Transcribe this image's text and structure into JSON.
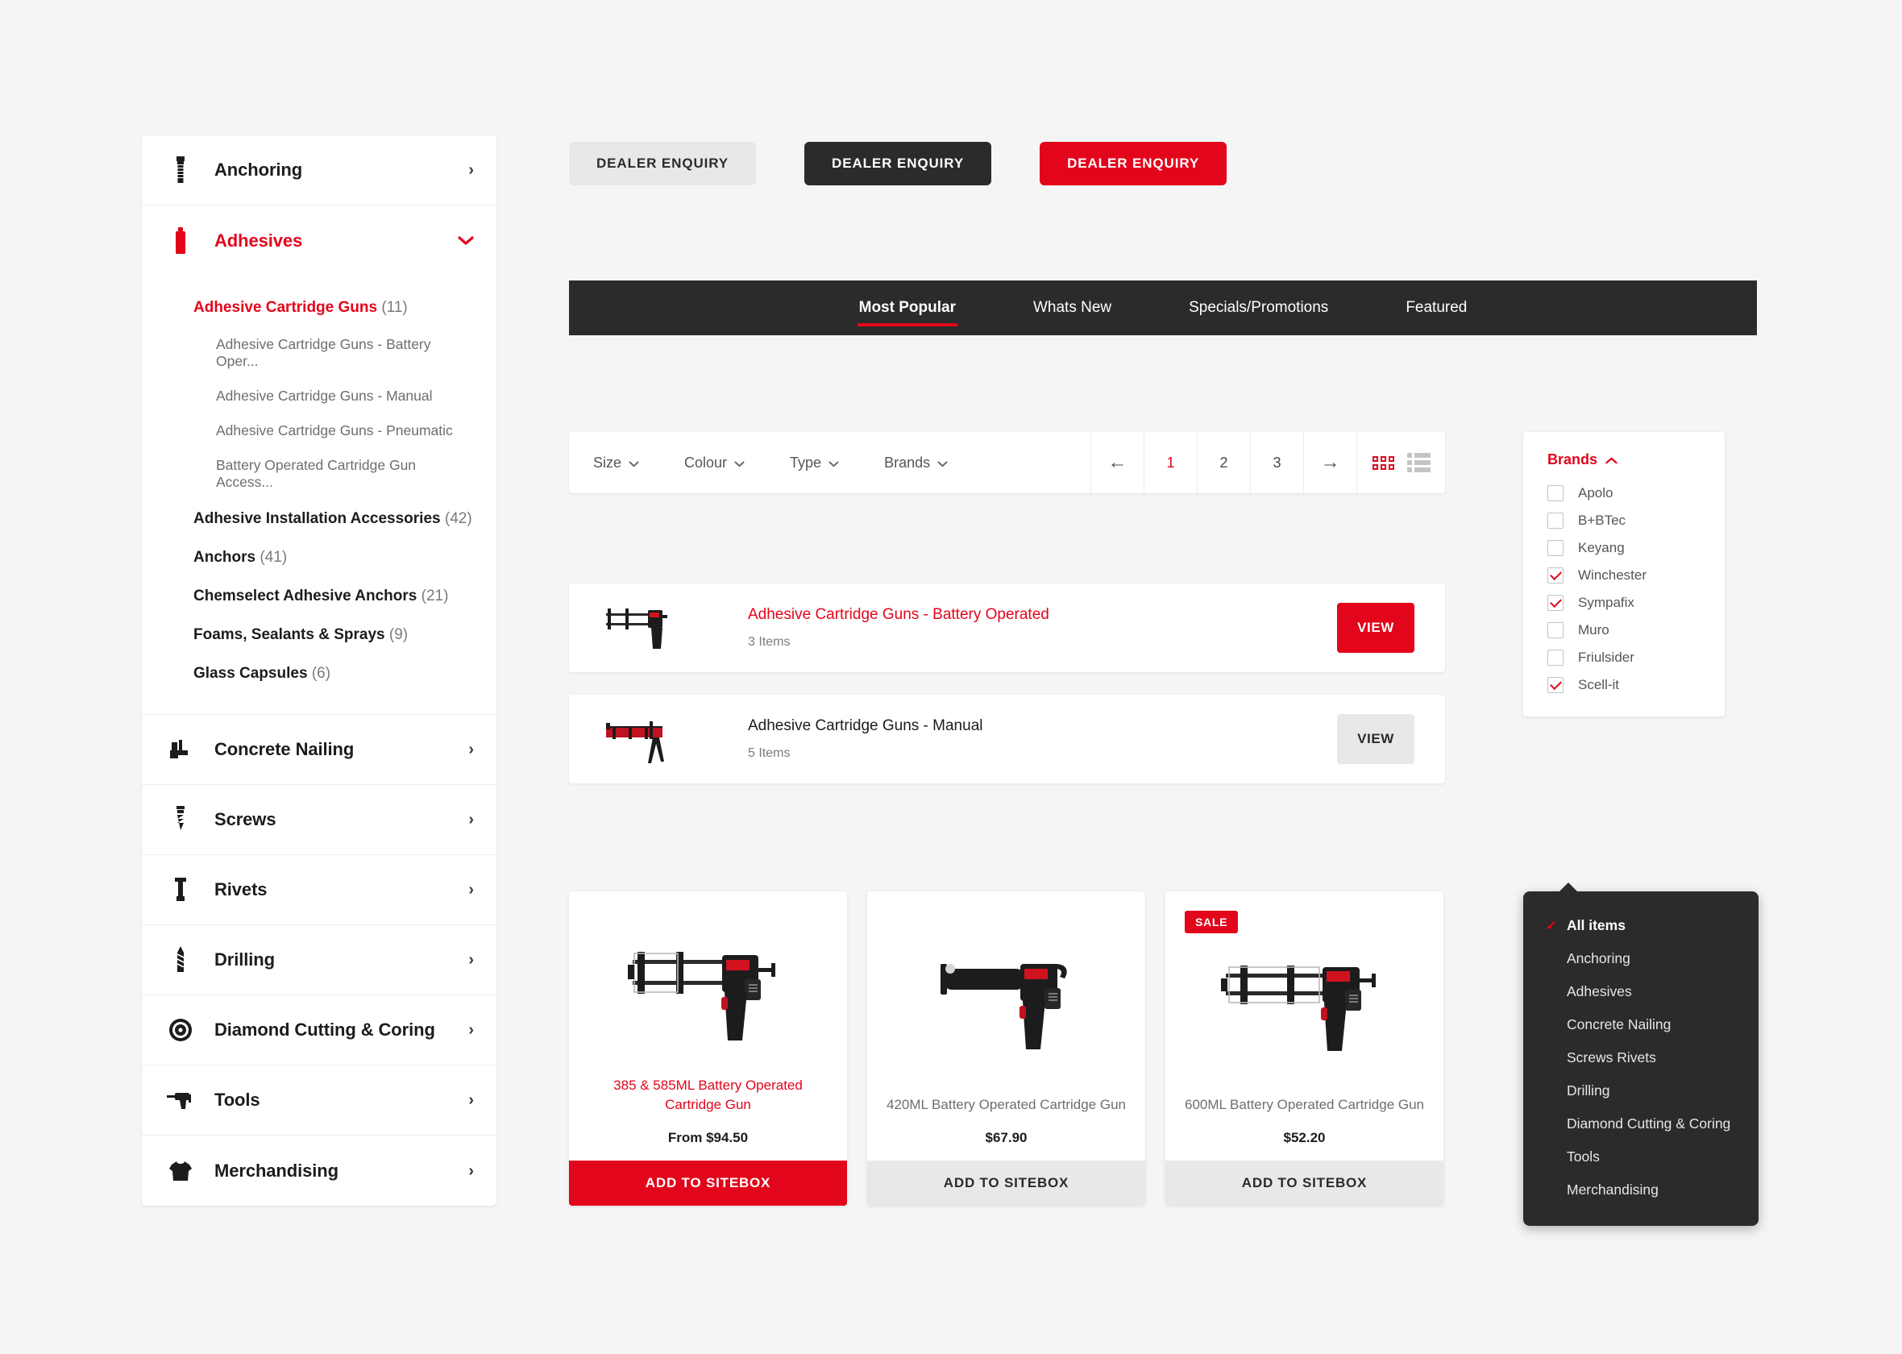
{
  "colors": {
    "accent": "#e3051b",
    "dark": "#2b2b2b",
    "bg": "#f5f5f5",
    "grey_btn": "#e8e8e8"
  },
  "top_buttons": [
    {
      "label": "DEALER ENQUIRY",
      "style": "grey"
    },
    {
      "label": "DEALER ENQUIRY",
      "style": "dark"
    },
    {
      "label": "DEALER ENQUIRY",
      "style": "red"
    }
  ],
  "sidebar": {
    "items": [
      {
        "label": "Anchoring",
        "icon": "anchor-bolt-icon",
        "state": "collapsed"
      },
      {
        "label": "Adhesives",
        "icon": "adhesive-cartridge-icon",
        "state": "expanded"
      },
      {
        "label": "Concrete Nailing",
        "icon": "nail-gun-icon",
        "state": "collapsed"
      },
      {
        "label": "Screws",
        "icon": "screw-icon",
        "state": "collapsed"
      },
      {
        "label": "Rivets",
        "icon": "rivet-icon",
        "state": "collapsed"
      },
      {
        "label": "Drilling",
        "icon": "drill-bit-icon",
        "state": "collapsed"
      },
      {
        "label": "Diamond Cutting & Coring",
        "icon": "saw-blade-icon",
        "state": "collapsed"
      },
      {
        "label": "Tools",
        "icon": "power-drill-icon",
        "state": "collapsed"
      },
      {
        "label": "Merchandising",
        "icon": "tshirt-icon",
        "state": "collapsed"
      }
    ],
    "adhesives_sub": [
      {
        "label": "Adhesive Cartridge Guns",
        "count": "(11)",
        "active": true
      },
      {
        "label": "Adhesive Cartridge Guns - Battery Oper...",
        "child": true
      },
      {
        "label": "Adhesive Cartridge Guns - Manual",
        "child": true
      },
      {
        "label": "Adhesive Cartridge Guns - Pneumatic",
        "child": true
      },
      {
        "label": "Battery Operated Cartridge Gun Access...",
        "child": true
      },
      {
        "label": "Adhesive Installation Accessories",
        "count": "(42)"
      },
      {
        "label": "Anchors",
        "count": "(41)"
      },
      {
        "label": "Chemselect Adhesive Anchors",
        "count": "(21)"
      },
      {
        "label": "Foams, Sealants & Sprays",
        "count": "(9)"
      },
      {
        "label": "Glass Capsules",
        "count": "(6)"
      }
    ]
  },
  "tabs": [
    {
      "label": "Most Popular",
      "active": true
    },
    {
      "label": "Whats New",
      "active": false
    },
    {
      "label": "Specials/Promotions",
      "active": false
    },
    {
      "label": "Featured",
      "active": false
    }
  ],
  "filterbar": {
    "filters": [
      {
        "label": "Size",
        "icon": "chevron-down-icon"
      },
      {
        "label": "Colour",
        "icon": "chevron-down-icon"
      },
      {
        "label": "Type",
        "icon": "chevron-down-icon"
      },
      {
        "label": "Brands",
        "icon": "chevron-down-icon"
      }
    ],
    "prev_icon": "arrow-left-icon",
    "next_icon": "arrow-right-icon",
    "pages": [
      {
        "label": "1",
        "active": true
      },
      {
        "label": "2",
        "active": false
      },
      {
        "label": "3",
        "active": false
      }
    ],
    "grid_view_icon": "grid-view-icon",
    "list_view_icon": "list-view-icon"
  },
  "brands_panel": {
    "title": "Brands",
    "toggle_icon": "chevron-up-icon",
    "items": [
      {
        "label": "Apolo",
        "checked": false
      },
      {
        "label": "B+BTec",
        "checked": false
      },
      {
        "label": "Keyang",
        "checked": false
      },
      {
        "label": "Winchester",
        "checked": true
      },
      {
        "label": "Sympafix",
        "checked": true
      },
      {
        "label": "Muro",
        "checked": false
      },
      {
        "label": "Friulsider",
        "checked": false
      },
      {
        "label": "Scell-it",
        "checked": true
      }
    ]
  },
  "category_rows": [
    {
      "title": "Adhesive Cartridge Guns - Battery Operated",
      "count": "3 Items",
      "button": "VIEW",
      "highlighted": true
    },
    {
      "title": "Adhesive Cartridge Guns - Manual",
      "count": "5 Items",
      "button": "VIEW",
      "highlighted": false
    }
  ],
  "products": [
    {
      "name": "385 & 585ML Battery Operated Cartridge Gun",
      "price": "From $94.50",
      "button": "ADD TO SITEBOX",
      "highlighted": true,
      "sale": false
    },
    {
      "name": "420ML Battery Operated Cartridge Gun",
      "price": "$67.90",
      "button": "ADD TO SITEBOX",
      "highlighted": false,
      "sale": false
    },
    {
      "name": "600ML Battery Operated Cartridge Gun",
      "price": "$52.20",
      "button": "ADD TO SITEBOX",
      "highlighted": false,
      "sale": true,
      "sale_label": "SALE"
    }
  ],
  "dropdown": {
    "check_icon": "check-icon",
    "items": [
      {
        "label": "All items",
        "selected": true
      },
      {
        "label": "Anchoring",
        "selected": false
      },
      {
        "label": "Adhesives",
        "selected": false
      },
      {
        "label": "Concrete Nailing",
        "selected": false
      },
      {
        "label": "Screws Rivets",
        "selected": false
      },
      {
        "label": "Drilling",
        "selected": false
      },
      {
        "label": "Diamond Cutting & Coring",
        "selected": false
      },
      {
        "label": "Tools",
        "selected": false
      },
      {
        "label": "Merchandising",
        "selected": false
      }
    ]
  }
}
